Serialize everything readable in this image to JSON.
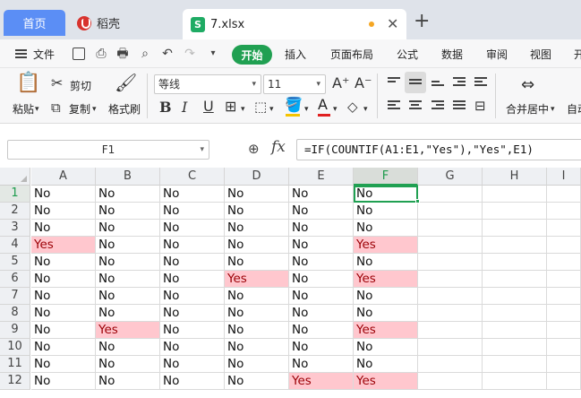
{
  "window": {
    "tabs": [
      {
        "label": "首页"
      },
      {
        "label": "稻壳"
      },
      {
        "label": "7.xlsx",
        "icon": "S"
      }
    ],
    "add_tab_icon": "plus-icon"
  },
  "menu": {
    "file": "文件",
    "tabs": [
      "开始",
      "插入",
      "页面布局",
      "公式",
      "数据",
      "审阅",
      "视图",
      "开"
    ],
    "active_tab": "开始"
  },
  "ribbon": {
    "paste": "粘贴",
    "cut": "剪切",
    "copy": "复制",
    "format_painter": "格式刷",
    "font_name": "等线",
    "font_size": "11",
    "merge_center": "合并居中",
    "auto_wrap": "自动"
  },
  "formula_bar": {
    "name_box": "F1",
    "fx": "fx",
    "formula": "=IF(COUNTIF(A1:E1,\"Yes\"),\"Yes\",E1)"
  },
  "sheet": {
    "columns": [
      "A",
      "B",
      "C",
      "D",
      "E",
      "F",
      "G",
      "H",
      "I"
    ],
    "rows": [
      "1",
      "2",
      "3",
      "4",
      "5",
      "6",
      "7",
      "8",
      "9",
      "10",
      "11",
      "12"
    ],
    "selected_cell": "F1",
    "highlight_color": "#ffc7ce",
    "cells": [
      [
        "No",
        "No",
        "No",
        "No",
        "No",
        "No"
      ],
      [
        "No",
        "No",
        "No",
        "No",
        "No",
        "No"
      ],
      [
        "No",
        "No",
        "No",
        "No",
        "No",
        "No"
      ],
      [
        "Yes",
        "No",
        "No",
        "No",
        "No",
        "Yes"
      ],
      [
        "No",
        "No",
        "No",
        "No",
        "No",
        "No"
      ],
      [
        "No",
        "No",
        "No",
        "Yes",
        "No",
        "Yes"
      ],
      [
        "No",
        "No",
        "No",
        "No",
        "No",
        "No"
      ],
      [
        "No",
        "No",
        "No",
        "No",
        "No",
        "No"
      ],
      [
        "No",
        "Yes",
        "No",
        "No",
        "No",
        "Yes"
      ],
      [
        "No",
        "No",
        "No",
        "No",
        "No",
        "No"
      ],
      [
        "No",
        "No",
        "No",
        "No",
        "No",
        "No"
      ],
      [
        "No",
        "No",
        "No",
        "No",
        "Yes",
        "Yes"
      ]
    ]
  }
}
